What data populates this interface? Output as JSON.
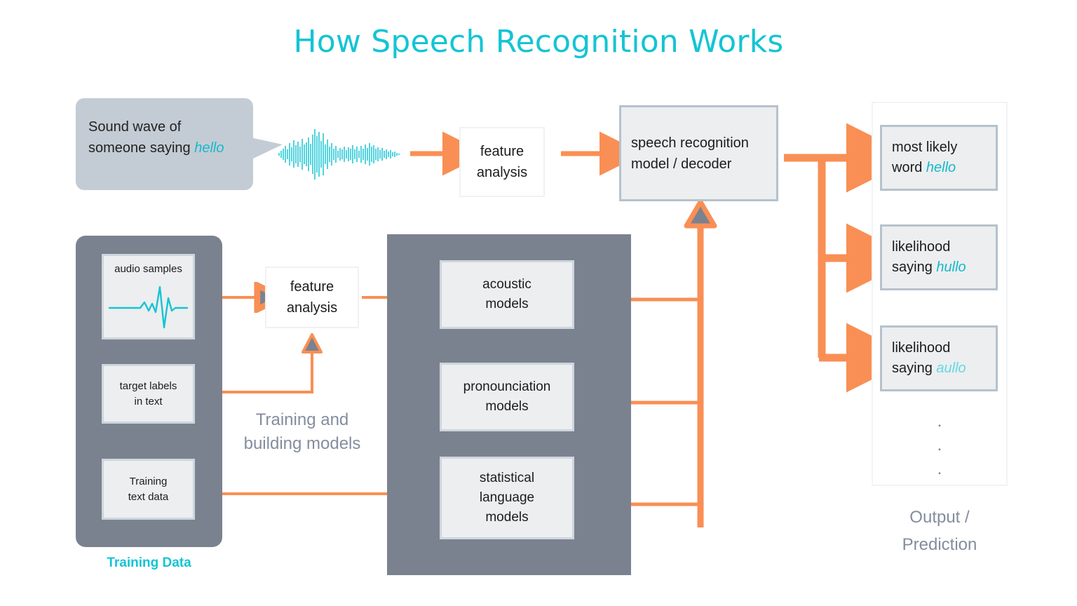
{
  "title": "How Speech Recognition Works",
  "colors": {
    "accent_cyan": "#14c4d4",
    "arrow_orange": "#f98f54",
    "panel_gray": "#7b828f",
    "box_fill": "#eceef0",
    "box_border": "#b6c2cc",
    "muted_text": "#848d9e",
    "bubble_fill": "#c3ccd4"
  },
  "input": {
    "bubble_line1": "Sound wave of",
    "bubble_line2_prefix": "someone saying ",
    "bubble_word": "hello",
    "waveform_icon": "sound-waveform"
  },
  "pipeline": {
    "feature_analysis": "feature\nanalysis",
    "feature_analysis_l1": "feature",
    "feature_analysis_l2": "analysis",
    "decoder_l1": "speech recognition",
    "decoder_l2": "model / decoder"
  },
  "training": {
    "panel_label": "Training Data",
    "items": [
      {
        "label": "audio samples",
        "icon": "waveform-icon"
      },
      {
        "label_l1": "target labels",
        "label_l2": "in text"
      },
      {
        "label_l1": "Training",
        "label_l2": "text data"
      }
    ],
    "feature_analysis_l1": "feature",
    "feature_analysis_l2": "analysis",
    "stage_label_l1": "Training and",
    "stage_label_l2": "building models"
  },
  "models": [
    {
      "l1": "acoustic",
      "l2": "models",
      "l3": ""
    },
    {
      "l1": "pronounciation",
      "l2": "models",
      "l3": ""
    },
    {
      "l1": "statistical",
      "l2": "language",
      "l3": "models"
    }
  ],
  "output": {
    "caption_l1": "Output /",
    "caption_l2": "Prediction",
    "ellipsis": ".\n.\n.",
    "items": [
      {
        "l1": "most likely",
        "l2_prefix": "word ",
        "word": "hello",
        "faded": false
      },
      {
        "l1": "likelihood",
        "l2_prefix": "saying ",
        "word": "hullo",
        "faded": false
      },
      {
        "l1": "likelihood",
        "l2_prefix": "saying ",
        "word": "aullo",
        "faded": true
      }
    ]
  }
}
